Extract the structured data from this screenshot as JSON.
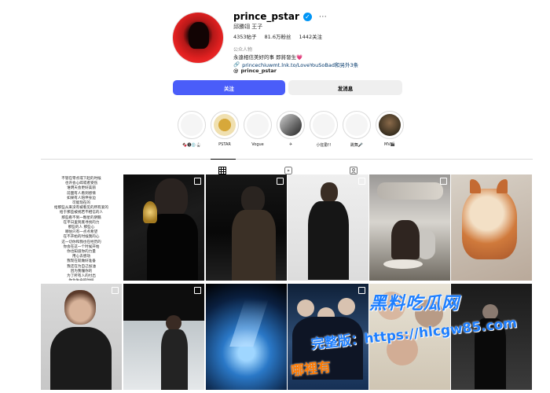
{
  "profile": {
    "username": "prince_pstar",
    "display_name": "邱勝翊 王子",
    "posts": "4353帖子",
    "followers": "81.6万粉丝",
    "following": "1442关注",
    "category": "公众人物",
    "bio": "永遠相信美好的事 即將發生💗",
    "link": "princechiuwmt.lnk.to/LoveYouSoBad和另外3条",
    "threads_handle": "prince_pstar"
  },
  "buttons": {
    "follow": "关注",
    "message": "发消息"
  },
  "highlights": [
    {
      "label": "🍫🅢💿🥋"
    },
    {
      "label": "PSTAR"
    },
    {
      "label": "Vogue"
    },
    {
      "label": "✈"
    },
    {
      "label": "小狂歡!!"
    },
    {
      "label": "跳舞🎤"
    },
    {
      "label": "MV🎬"
    }
  ],
  "post1_poem": "不管在零点或下起的时候\n也许会心碎或者受伤\n谁明天会更好美丽\n前面有人看到感情\n如果有人陪伴身边\n可能现在的\n给那些从来没有被看见的所有爱的\n给于那些被视若不相信的人\n那些看不到一颗星的阴翳\n在平日里到底寻找的力\n那些的人 那些心\n哪怕只有一点点希望\n在不开始的时候我的心\n这一切你和我也在经历的\n你会在这一个时候开始\n你也知道你的力量\n用心去感动\n我现在就做好准备\n我还在为自己加油\n因为我懂你的\n为了所有人的付出\n你为生命的时候\n我知道我的内心\n我们在这里等待你的到来\n\n我们在这里\n\n我的生命\n\n你和我\n\n\n我们在你\n\n\n和你的爱",
  "watermark": {
    "line1": "黑料吃瓜网",
    "line2": "完整版：https://hlcgw85.com",
    "line3": "哪裡有"
  }
}
